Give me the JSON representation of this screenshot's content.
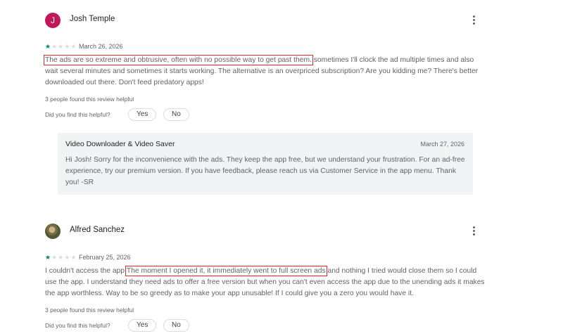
{
  "reviews": [
    {
      "author": "Josh Temple",
      "avatar_letter": "J",
      "avatar_color": "#c2185b",
      "rating": 1,
      "date": "March 26, 2026",
      "text_highlight": "The ads are so extreme and obtrusive, often with no possible way to get past them.",
      "text_rest": " sometimes I'll clock the ad multiple times and also wait several minutes and sometimes it starts working. The alternative is an overpriced subscription? Are you kidding me? There's better downloaded out there. Don't feed predatory apps!",
      "helpful_count": "3 people found this review helpful",
      "helpful_question": "Did you find this helpful?",
      "yes_label": "Yes",
      "no_label": "No",
      "reply": {
        "developer": "Video Downloader & Video Saver",
        "date": "March 27, 2026",
        "text": "Hi Josh! Sorry for the inconvenience with the ads. They keep the app free, but we understand your frustration. For an ad-free experience, try our premium version. If you have feedback, please reach us via Customer Service in the app menu. Thank you! -SR"
      }
    },
    {
      "author": "Alfred Sanchez",
      "rating": 1,
      "date": "February 25, 2026",
      "text_before": "I couldn't access the app!",
      "text_highlight": "The moment I opened it, it immediately went to full screen ads",
      "text_after": " and nothing I tried would close them so I could use the app. I understand they need ads to offer a free version but when you can't even access the app due to the unending ads it makes the app worthless. Way to be so greedy as to make your app unusable! If I could give you a zero you would have it.",
      "helpful_count": "3 people found this review helpful",
      "helpful_question": "Did you find this helpful?",
      "yes_label": "Yes",
      "no_label": "No"
    }
  ],
  "icons": {
    "more": "more-vert-icon",
    "star_filled": "★",
    "star_empty": "★"
  },
  "colors": {
    "star": "#01875f",
    "highlight_box": "#e5262f"
  }
}
